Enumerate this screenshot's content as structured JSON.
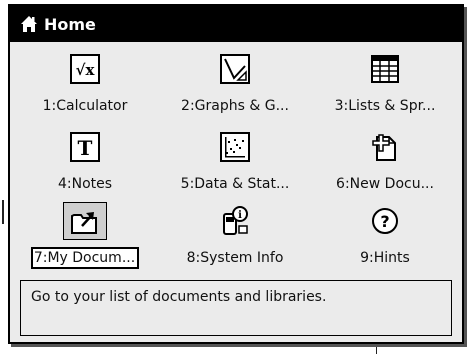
{
  "window": {
    "title": "Home",
    "icon": "home-icon"
  },
  "items": [
    {
      "id": "calculator",
      "label": "1:Calculator",
      "icon": "calculator-icon"
    },
    {
      "id": "graphs",
      "label": "2:Graphs & G...",
      "icon": "graphs-icon"
    },
    {
      "id": "lists",
      "label": "3:Lists & Spr...",
      "icon": "spreadsheet-icon"
    },
    {
      "id": "notes",
      "label": "4:Notes",
      "icon": "notes-icon"
    },
    {
      "id": "data",
      "label": "5:Data & Stat...",
      "icon": "data-stats-icon"
    },
    {
      "id": "new-document",
      "label": "6:New Docu...",
      "icon": "new-document-icon"
    },
    {
      "id": "my-documents",
      "label": "7:My Docum...",
      "icon": "folder-icon",
      "selected": true
    },
    {
      "id": "system-info",
      "label": "8:System Info",
      "icon": "system-info-icon"
    },
    {
      "id": "hints",
      "label": "9:Hints",
      "icon": "help-icon"
    }
  ],
  "status": {
    "text": "Go to your list of documents and libraries."
  }
}
